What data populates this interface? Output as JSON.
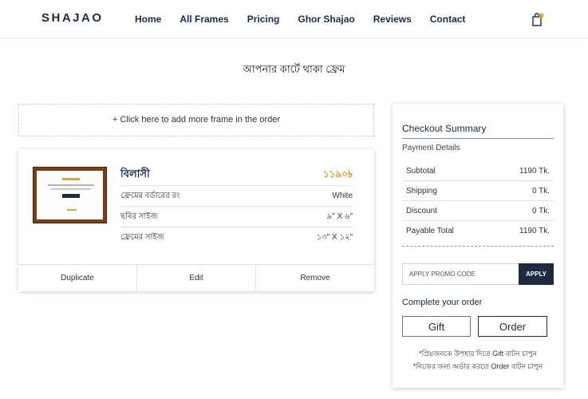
{
  "header": {
    "logo": "SHAJAO",
    "nav": [
      "Home",
      "All Frames",
      "Pricing",
      "Ghor Shajao",
      "Reviews",
      "Contact"
    ],
    "cart_icon": "shopping-bag-icon",
    "badge_color": "#f0a32b"
  },
  "page_title": "আপনার কার্টে থাকা ফ্রেম",
  "add_frame": "+ Click here to add more frame in the order",
  "item": {
    "name": "বিলাসী",
    "price": "১১৯০৳",
    "details": [
      {
        "label": "ফ্রেমের বর্ডারের রং",
        "value": "White"
      },
      {
        "label": "ছবির সাইজ",
        "value": "৯\" X ৬\""
      },
      {
        "label": "ফ্রেমের সাইজ",
        "value": "১৩\" X ১২\""
      }
    ],
    "actions": {
      "duplicate": "Duplicate",
      "edit": "Edit",
      "remove": "Remove"
    }
  },
  "checkout": {
    "title": "Checkout Summary",
    "subtitle": "Payment Details",
    "rows": [
      {
        "label": "Subtotal",
        "value": "1190 Tk."
      },
      {
        "label": "Shipping",
        "value": "0 Tk."
      },
      {
        "label": "Discount",
        "value": "0 Tk."
      },
      {
        "label": "Payable Total",
        "value": "1190 Tk."
      }
    ],
    "promo_placeholder": "APPLY PROMO CODE",
    "apply": "APPLY",
    "complete": "Complete your order",
    "gift": "Gift",
    "order": "Order",
    "note1": "*প্রিয়জনকে উপহার দিতে Gift বাটন চাপুন",
    "note2": "*নিজের জন্য অর্ডার করতে Order বাটন চাপুন"
  },
  "colors": {
    "navy": "#1d2a3f",
    "gold": "#d99a29"
  }
}
